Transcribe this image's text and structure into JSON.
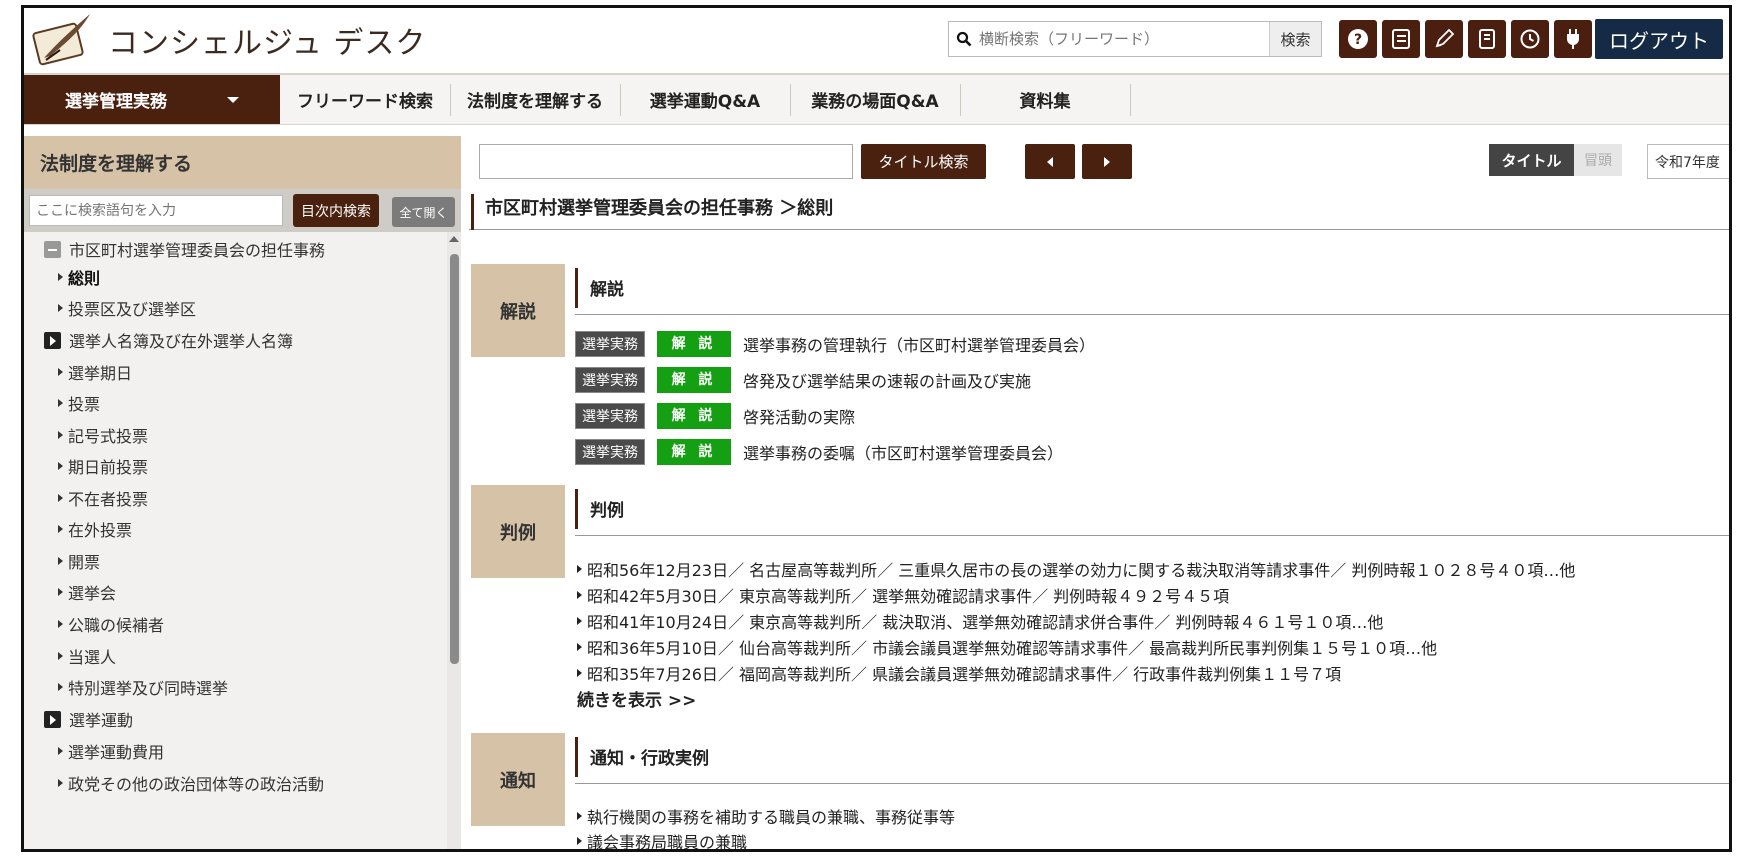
{
  "header": {
    "brand": "コンシェルジュ デスク",
    "search_placeholder": "横断検索（フリーワード）",
    "search_button": "検索",
    "logout": "ログアウト"
  },
  "nav": {
    "items": [
      {
        "label": "選挙管理実務"
      },
      {
        "label": "フリーワード検索"
      },
      {
        "label": "法制度を理解する"
      },
      {
        "label": "選挙運動Q&A"
      },
      {
        "label": "業務の場面Q&A"
      },
      {
        "label": "資料集"
      }
    ]
  },
  "sidebar": {
    "title": "法制度を理解する",
    "search_placeholder": "ここに検索語句を入力",
    "search_button": "目次内検索",
    "expand_all": "全て開く",
    "tree": [
      {
        "label": "市区町村選挙管理委員会の担任事務",
        "type": "open"
      },
      {
        "label": "総則",
        "type": "child-bold"
      },
      {
        "label": "投票区及び選挙区",
        "type": "child"
      },
      {
        "label": "選挙人名簿及び在外選挙人名簿",
        "type": "closed"
      },
      {
        "label": "選挙期日",
        "type": "child"
      },
      {
        "label": "投票",
        "type": "child"
      },
      {
        "label": "記号式投票",
        "type": "child"
      },
      {
        "label": "期日前投票",
        "type": "child"
      },
      {
        "label": "不在者投票",
        "type": "child"
      },
      {
        "label": "在外投票",
        "type": "child"
      },
      {
        "label": "開票",
        "type": "child"
      },
      {
        "label": "選挙会",
        "type": "child"
      },
      {
        "label": "公職の候補者",
        "type": "child"
      },
      {
        "label": "当選人",
        "type": "child"
      },
      {
        "label": "特別選挙及び同時選挙",
        "type": "child"
      },
      {
        "label": "選挙運動",
        "type": "closed"
      },
      {
        "label": "選挙運動費用",
        "type": "child"
      },
      {
        "label": "政党その他の政治団体等の政治活動",
        "type": "child"
      }
    ]
  },
  "toolbar": {
    "title_search": "タイトル検索",
    "seg_title": "タイトル",
    "seg_head": "冒頭",
    "year": "令和7年度"
  },
  "main": {
    "breadcrumb": "市区町村選挙管理委員会の担任事務 ＞総則",
    "sections": {
      "kaisetsu": {
        "tab": "解説",
        "heading": "解説",
        "items": [
          {
            "badge1": "選挙実務",
            "badge2": "解 説",
            "text": "選挙事務の管理執行（市区町村選挙管理委員会）"
          },
          {
            "badge1": "選挙実務",
            "badge2": "解 説",
            "text": "啓発及び選挙結果の速報の計画及び実施"
          },
          {
            "badge1": "選挙実務",
            "badge2": "解 説",
            "text": "啓発活動の実際"
          },
          {
            "badge1": "選挙実務",
            "badge2": "解 説",
            "text": "選挙事務の委嘱（市区町村選挙管理委員会）"
          }
        ]
      },
      "hanrei": {
        "tab": "判例",
        "heading": "判例",
        "items": [
          "昭和56年12月23日／ 名古屋高等裁判所／ 三重県久居市の長の選挙の効力に関する裁決取消等請求事件／ 判例時報１０２８号４０項…他",
          "昭和42年5月30日／ 東京高等裁判所／ 選挙無効確認請求事件／ 判例時報４９２号４５項",
          "昭和41年10月24日／ 東京高等裁判所／ 裁決取消、選挙無効確認請求併合事件／ 判例時報４６１号１０項…他",
          "昭和36年5月10日／ 仙台高等裁判所／ 市議会議員選挙無効確認等請求事件／ 最高裁判所民事判例集１５号１０項…他",
          "昭和35年7月26日／ 福岡高等裁判所／ 県議会議員選挙無効確認請求事件／ 行政事件裁判例集１１号７項"
        ],
        "more": "続きを表示 >>"
      },
      "tsuchi": {
        "tab": "通知",
        "heading": "通知・行政実例",
        "items": [
          "執行機関の事務を補助する職員の兼職、事務従事等",
          "議会事務局職員の兼職"
        ]
      }
    }
  },
  "colors": {
    "brown": "#4a200e",
    "tab_tan": "#d6c3a7",
    "green_badge": "#14a012",
    "logout_navy": "#142a45"
  },
  "icons": [
    "quill-logo-icon",
    "search-icon",
    "help-icon",
    "bookmark-list-icon",
    "pen-icon",
    "notebook-icon",
    "history-icon",
    "plug-icon"
  ]
}
